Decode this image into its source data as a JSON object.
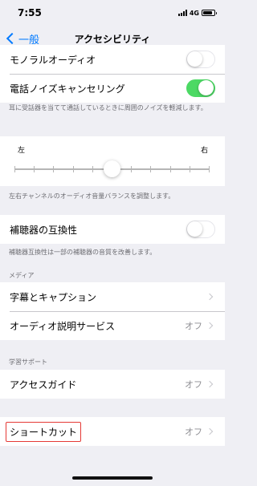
{
  "status_bar": {
    "time": "7:55",
    "network": "4G",
    "battery_level": 0.85
  },
  "nav": {
    "back_label": "一般",
    "title": "アクセシビリティ"
  },
  "hearing_group": {
    "mono_audio": {
      "label": "モノラルオーディオ",
      "on": false
    },
    "noise_cancel": {
      "label": "電話ノイズキャンセリング",
      "on": true
    }
  },
  "noise_note": "耳に受話器を当てて通話しているときに周囲のノイズを軽減します。",
  "balance": {
    "left_label": "左",
    "right_label": "右",
    "position": 0.5,
    "note": "左右チャンネルのオーディオ音量バランスを調整します。"
  },
  "hac": {
    "label": "補聴器の互換性",
    "on": false,
    "note": "補聴器互換性は一部の補聴器の音質を改善します。"
  },
  "media": {
    "header": "メディア",
    "captions": {
      "label": "字幕とキャプション"
    },
    "audio_desc": {
      "label": "オーディオ説明サービス",
      "value": "オフ"
    }
  },
  "learning": {
    "header": "学習サポート",
    "guided_access": {
      "label": "アクセスガイド",
      "value": "オフ"
    }
  },
  "shortcut": {
    "label": "ショートカット",
    "value": "オフ"
  },
  "colors": {
    "accent": "#007aff",
    "toggle_on": "#4cd964",
    "highlight": "#e53935"
  }
}
